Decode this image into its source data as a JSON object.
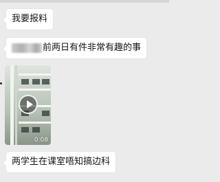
{
  "messages": [
    {
      "text": "我要报料"
    },
    {
      "text": "前两日有件非常有趣的事"
    },
    {
      "video_duration": "0:08"
    },
    {
      "text": "两学生在课室唔知搞边科"
    }
  ],
  "icons": {
    "play": "play-icon"
  }
}
